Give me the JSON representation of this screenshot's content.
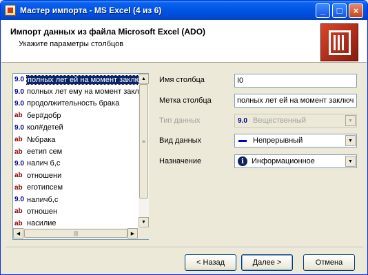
{
  "window": {
    "title": "Мастер импорта - MS Excel (4 из 6)"
  },
  "header": {
    "title": "Импорт данных из файла Microsoft Excel (ADO)",
    "subtitle": "Укажите параметры  столбцов"
  },
  "columns": [
    {
      "type": "9.0",
      "kind": "num",
      "label": "полных лет ей на момент заклю",
      "selected": true
    },
    {
      "type": "9.0",
      "kind": "num",
      "label": "полных лет ему на момент закл"
    },
    {
      "type": "9.0",
      "kind": "num",
      "label": "продолжительность брака"
    },
    {
      "type": "ab",
      "kind": "ab",
      "label": "бер#добр"
    },
    {
      "type": "9.0",
      "kind": "num",
      "label": "кол#детей"
    },
    {
      "type": "ab",
      "kind": "ab",
      "label": "№брака"
    },
    {
      "type": "ab",
      "kind": "ab",
      "label": "еетип сем"
    },
    {
      "type": "9.0",
      "kind": "num",
      "label": "налич б,с"
    },
    {
      "type": "ab",
      "kind": "ab",
      "label": "отношени"
    },
    {
      "type": "ab",
      "kind": "ab",
      "label": "еготипсем"
    },
    {
      "type": "9.0",
      "kind": "num",
      "label": "наличб,с"
    },
    {
      "type": "ab",
      "kind": "ab",
      "label": "отношен"
    },
    {
      "type": "ab",
      "kind": "ab",
      "label": "насилие"
    }
  ],
  "form": {
    "name_label": "Имя столбца",
    "name_value": "I0",
    "mark_label": "Метка столбца",
    "mark_value": "полных лет ей на момент заключ",
    "type_label": "Тип данных",
    "type_icon": "9.0",
    "type_value": "Вещественный",
    "kind_label": "Вид данных",
    "kind_value": "Непрерывный",
    "purpose_label": "Назначение",
    "purpose_icon": "i",
    "purpose_value": "Информационное"
  },
  "buttons": {
    "back": "< Назад",
    "next": "Далее >",
    "cancel": "Отмена"
  }
}
